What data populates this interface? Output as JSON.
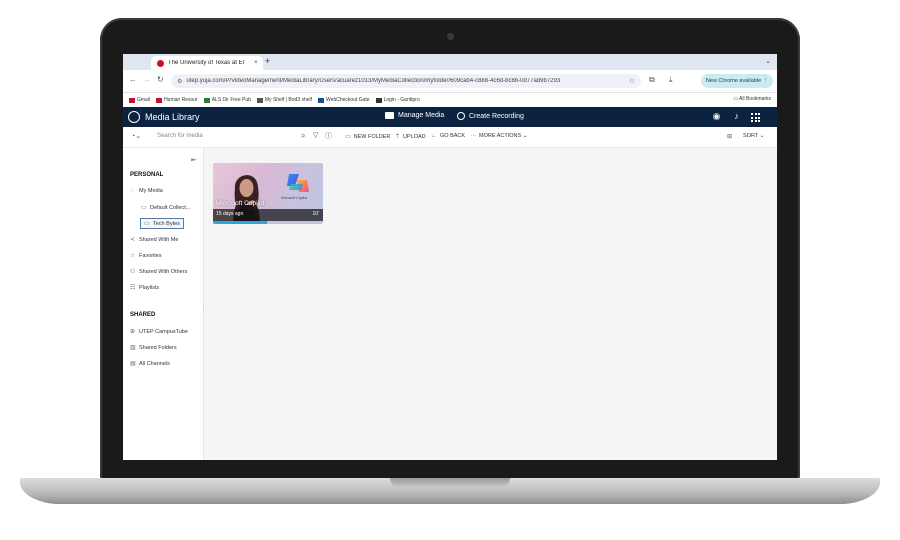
{
  "browser": {
    "tab_title": "The University of Texas at El",
    "tab_close": "×",
    "new_tab": "+",
    "tab_menu": "⌄",
    "url": "utep.yuja.com/P/VideoManagement/MediaLibrary/Users/acuarez1013/MyMediaCollection/myfolder/609cab4-c888-4c6d-bc8b-0d77ad9b7293",
    "update_label": "New Chrome available",
    "bookmarks": [
      "Gmail",
      "Human Resour",
      "ALS Dir Free Pub",
      "My Shelf | Bod3 shelf",
      "WebCheckout Gate",
      "Login - Ganttpro"
    ],
    "bookmarks_right": "All Bookmarks"
  },
  "app": {
    "title": "Media Library",
    "manage_media": "Manage Media",
    "create_recording": "Create Recording"
  },
  "toolbar": {
    "search_placeholder": "Search for media",
    "new_folder": "NEW FOLDER",
    "upload": "UPLOAD",
    "go_back": "GO BACK",
    "more_actions": "MORE ACTIONS",
    "sort": "SORT"
  },
  "sidebar": {
    "personal_heading": "PERSONAL",
    "my_media": "My Media",
    "default_collection": "Default Collect...",
    "tech_bytes": "Tech Bytes",
    "shared_with_me": "Shared With Me",
    "favorites": "Favorites",
    "shared_with_others": "Shared With Others",
    "playlists": "Playlists",
    "shared_heading": "SHARED",
    "campustube": "UTEP CampusTube",
    "shared_folders": "Shared Folders",
    "all_channels": "All Channels"
  },
  "media": [
    {
      "title": "Microsoft Copilot",
      "date": "15 days ago",
      "duration": "10'",
      "logo_label": "Microsoft Copilot",
      "progress_fraction": 0.49
    }
  ],
  "colors": {
    "header_bg": "#0b2341",
    "accent": "#2aa7e0",
    "favicon": "#c8102e"
  }
}
